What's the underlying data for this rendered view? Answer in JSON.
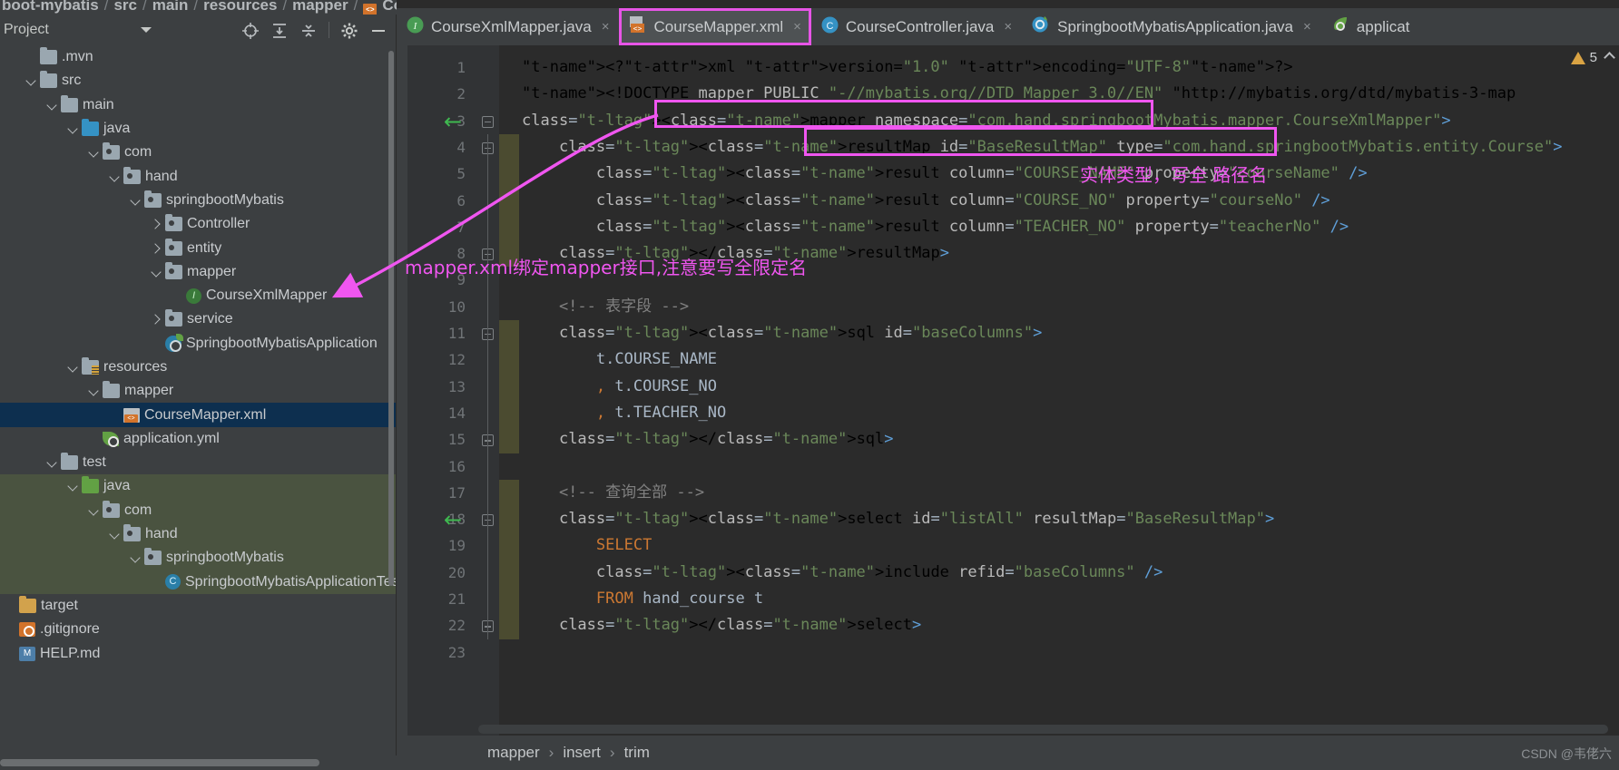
{
  "breadcrumb_top": {
    "segments": [
      "boot-mybatis",
      "src",
      "main",
      "resources",
      "mapper"
    ],
    "file": "CourseMapper.xml",
    "separator": "/"
  },
  "project_panel": {
    "title": "Project",
    "icons": [
      {
        "name": "locate-icon",
        "glyph": "locate"
      },
      {
        "name": "expand-all-icon",
        "glyph": "expand"
      },
      {
        "name": "collapse-all-icon",
        "glyph": "collapse"
      },
      {
        "name": "settings-gear-icon",
        "glyph": "gear"
      },
      {
        "name": "hide-panel-icon",
        "glyph": "minus"
      }
    ],
    "tree": [
      {
        "label": ".mvn",
        "depth": 1,
        "arrow": "none",
        "icon": "folder",
        "state": "normal"
      },
      {
        "label": "src",
        "depth": 1,
        "arrow": "open",
        "icon": "folder",
        "state": "normal"
      },
      {
        "label": "main",
        "depth": 2,
        "arrow": "open",
        "icon": "folder",
        "state": "normal"
      },
      {
        "label": "java",
        "depth": 3,
        "arrow": "open",
        "icon": "src",
        "state": "normal"
      },
      {
        "label": "com",
        "depth": 4,
        "arrow": "open",
        "icon": "pkg",
        "state": "normal"
      },
      {
        "label": "hand",
        "depth": 5,
        "arrow": "open",
        "icon": "pkg",
        "state": "normal"
      },
      {
        "label": "springbootMybatis",
        "depth": 6,
        "arrow": "open",
        "icon": "pkg",
        "state": "normal"
      },
      {
        "label": "Controller",
        "depth": 7,
        "arrow": "closed",
        "icon": "pkg",
        "state": "normal"
      },
      {
        "label": "entity",
        "depth": 7,
        "arrow": "closed",
        "icon": "pkg",
        "state": "normal"
      },
      {
        "label": "mapper",
        "depth": 7,
        "arrow": "open",
        "icon": "pkg",
        "state": "normal"
      },
      {
        "label": "CourseXmlMapper",
        "depth": 8,
        "arrow": "none",
        "icon": "iface",
        "state": "normal"
      },
      {
        "label": "service",
        "depth": 7,
        "arrow": "closed",
        "icon": "pkg",
        "state": "normal"
      },
      {
        "label": "SpringbootMybatisApplication",
        "depth": 7,
        "arrow": "none",
        "icon": "spring",
        "state": "normal"
      },
      {
        "label": "resources",
        "depth": 3,
        "arrow": "open",
        "icon": "res",
        "state": "normal"
      },
      {
        "label": "mapper",
        "depth": 4,
        "arrow": "open",
        "icon": "folder",
        "state": "normal"
      },
      {
        "label": "CourseMapper.xml",
        "depth": 5,
        "arrow": "none",
        "icon": "xml",
        "state": "selected"
      },
      {
        "label": "application.yml",
        "depth": 4,
        "arrow": "none",
        "icon": "yml",
        "state": "normal"
      },
      {
        "label": "test",
        "depth": 2,
        "arrow": "open",
        "icon": "folder",
        "state": "normal"
      },
      {
        "label": "java",
        "depth": 3,
        "arrow": "open",
        "icon": "test",
        "state": "testscope"
      },
      {
        "label": "com",
        "depth": 4,
        "arrow": "open",
        "icon": "pkg",
        "state": "testscope"
      },
      {
        "label": "hand",
        "depth": 5,
        "arrow": "open",
        "icon": "pkg",
        "state": "testscope"
      },
      {
        "label": "springbootMybatis",
        "depth": 6,
        "arrow": "open",
        "icon": "pkg",
        "state": "testscope"
      },
      {
        "label": "SpringbootMybatisApplicationTes",
        "depth": 7,
        "arrow": "none",
        "icon": "cls",
        "state": "testscope"
      },
      {
        "label": "target",
        "depth": 0,
        "arrow": "none",
        "icon": "target",
        "state": "normal"
      },
      {
        "label": ".gitignore",
        "depth": 0,
        "arrow": "none",
        "icon": "git",
        "state": "normal"
      },
      {
        "label": "HELP.md",
        "depth": 0,
        "arrow": "none",
        "icon": "md",
        "state": "normal"
      }
    ]
  },
  "tabs": [
    {
      "label": "CourseXmlMapper.java",
      "icon": "interface-icon",
      "active": false,
      "highlighted": false,
      "close": "×"
    },
    {
      "label": "CourseMapper.xml",
      "icon": "xml-file-icon",
      "active": true,
      "highlighted": true,
      "close": "×"
    },
    {
      "label": "CourseController.java",
      "icon": "class-icon",
      "active": false,
      "highlighted": false,
      "close": "×"
    },
    {
      "label": "SpringbootMybatisApplication.java",
      "icon": "spring-icon",
      "active": false,
      "highlighted": false,
      "close": "×"
    },
    {
      "label": "applicat",
      "icon": "yml-file-icon",
      "active": false,
      "highlighted": false,
      "close": ""
    }
  ],
  "inspection": {
    "warning_count": "5",
    "icon": "warning-triangle-icon",
    "collapse_icon": "chevron-up-icon"
  },
  "editor": {
    "lines": [
      {
        "n": "1",
        "text": "<?xml version=\"1.0\" encoding=\"UTF-8\"?>"
      },
      {
        "n": "2",
        "text": "<!DOCTYPE mapper PUBLIC \"-//mybatis.org//DTD Mapper 3.0//EN\" \"http://mybatis.org/dtd/mybatis-3-map"
      },
      {
        "n": "3",
        "text": "<mapper namespace=\"com.hand.springbootMybatis.mapper.CourseXmlMapper\">"
      },
      {
        "n": "4",
        "text": "    <resultMap id=\"BaseResultMap\" type=\"com.hand.springbootMybatis.entity.Course\">"
      },
      {
        "n": "5",
        "text": "        <result column=\"COURSE_NAME\" property=\"courseName\" />"
      },
      {
        "n": "6",
        "text": "        <result column=\"COURSE_NO\" property=\"courseNo\" />"
      },
      {
        "n": "7",
        "text": "        <result column=\"TEACHER_NO\" property=\"teacherNo\" />"
      },
      {
        "n": "8",
        "text": "    </resultMap>"
      },
      {
        "n": "9",
        "text": ""
      },
      {
        "n": "10",
        "text": "    <!-- 表字段 -->"
      },
      {
        "n": "11",
        "text": "    <sql id=\"baseColumns\">"
      },
      {
        "n": "12",
        "text": "        t.COURSE_NAME"
      },
      {
        "n": "13",
        "text": "        , t.COURSE_NO"
      },
      {
        "n": "14",
        "text": "        , t.TEACHER_NO"
      },
      {
        "n": "15",
        "text": "    </sql>"
      },
      {
        "n": "16",
        "text": ""
      },
      {
        "n": "17",
        "text": "    <!-- 查询全部 -->"
      },
      {
        "n": "18",
        "text": "    <select id=\"listAll\" resultMap=\"BaseResultMap\">"
      },
      {
        "n": "19",
        "text": "        SELECT"
      },
      {
        "n": "20",
        "text": "        <include refid=\"baseColumns\" />"
      },
      {
        "n": "21",
        "text": "        FROM hand_course t"
      },
      {
        "n": "22",
        "text": "    </select>"
      },
      {
        "n": "23",
        "text": ""
      }
    ],
    "gutter_arrows": [
      "3",
      "18"
    ]
  },
  "annotations": {
    "note_entity": "实体类型，写全 路径名",
    "note_namespace": "mapper.xml绑定mapper接口,注意要写全限定名",
    "accent_color": "#f056f0"
  },
  "bottom_breadcrumb": {
    "items": [
      "mapper",
      "insert",
      "trim"
    ],
    "separator": "›"
  },
  "watermark": "CSDN @韦佬六"
}
